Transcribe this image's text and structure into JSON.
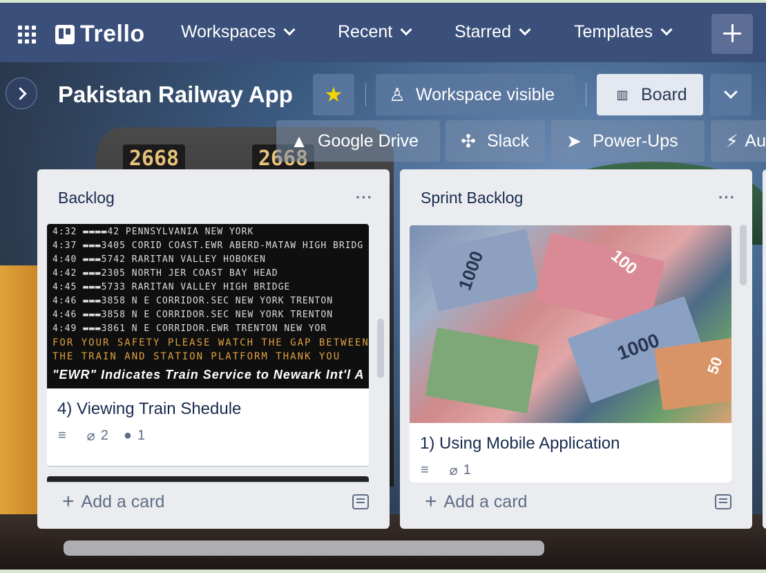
{
  "header": {
    "logo_text": "Trello",
    "nav": [
      "Workspaces",
      "Recent",
      "Starred",
      "Templates"
    ],
    "create_label": "+"
  },
  "board": {
    "title": "Pakistan Railway App",
    "visibility_label": "Workspace visible",
    "view_label": "Board",
    "powerups": [
      "Google Drive",
      "Slack",
      "Power-Ups",
      "Au"
    ]
  },
  "background_text": {
    "engine_number_left": "2668",
    "engine_number_right": "2668"
  },
  "lists": [
    {
      "title": "Backlog",
      "menu": "···",
      "cards": [
        {
          "title": "4) Viewing Train Shedule",
          "attachments": "2",
          "github": "1",
          "cover": {
            "rows": [
              "4:32 ▬▬▬▬42   PENNSYLVANIA            NEW YORK",
              "4:37 ▬▬▬3405 CORID  COAST.EWR  ABERD-MATAW  HIGH BRIDG",
              "4:40 ▬▬▬5742 RARITAN VALLEY              HOBOKEN",
              "4:42 ▬▬▬2305 NORTH JER  COAST  BAY HEAD",
              "4:45 ▬▬▬5733 RARITAN VALLEY  HIGH BRIDGE",
              "4:46 ▬▬▬3858 N E CORRIDOR.SEC  NEW YORK   TRENTON",
              "4:46 ▬▬▬3858 N E CORRIDOR.SEC  NEW YORK   TRENTON",
              "4:49 ▬▬▬3861 N E CORRIDOR.EWR  TRENTON    NEW YOR"
            ],
            "warning_1": "FOR YOUR SAFETY PLEASE WATCH THE GAP BETWEEN",
            "warning_2": "THE TRAIN AND STATION PLATFORM  THANK YOU",
            "footer": "\"EWR\" Indicates Train Service to Newark Int'l A"
          }
        }
      ],
      "add_label": "Add a card"
    },
    {
      "title": "Sprint Backlog",
      "menu": "···",
      "cards": [
        {
          "title": "1) Using Mobile Application",
          "attachments": "1",
          "cover": {
            "banknote_value": "1000",
            "banknote_value_2": "100",
            "banknote_value_3": "50"
          }
        }
      ],
      "add_label": "Add a card"
    }
  ],
  "colors": {
    "header_bg": "#3a4f7a",
    "list_bg": "#ebecf0",
    "text_dark": "#172b4d",
    "text_muted": "#5e6c84",
    "star": "#f2d600"
  }
}
